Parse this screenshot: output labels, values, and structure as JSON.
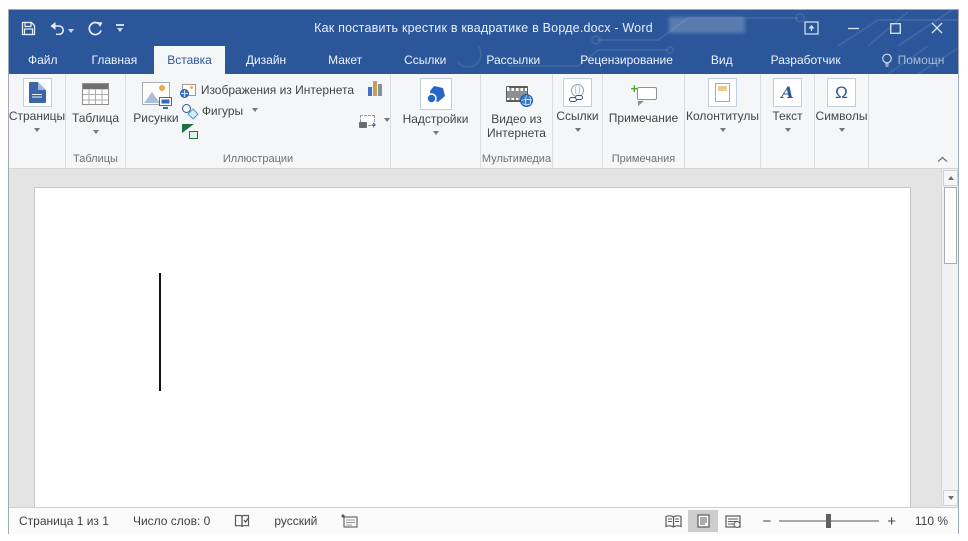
{
  "titlebar": {
    "title": "Как поставить крестик в квадратике в Ворде.docx - Word"
  },
  "tabs": {
    "file": "Файл",
    "home": "Главная",
    "insert": "Вставка",
    "design": "Дизайн",
    "layout": "Макет",
    "references": "Ссылки",
    "mailings": "Рассылки",
    "review": "Рецензирование",
    "view": "Вид",
    "developer": "Разработчик",
    "helper": "Помощн"
  },
  "ribbon": {
    "pages_label": "Страницы",
    "tables_group": "Таблицы",
    "table_label": "Таблица",
    "illustrations_group": "Иллюстрации",
    "pictures_label": "Рисунки",
    "online_pictures_label": "Изображения из Интернета",
    "shapes_label": "Фигуры",
    "addins_label": "Надстройки",
    "media_group": "Мультимедиа",
    "video_label": "Видео из Интернета",
    "links_label": "Ссылки",
    "comments_group": "Примечания",
    "comment_label": "Примечание",
    "header_footer_label": "Колонтитулы",
    "text_label": "Текст",
    "text_glyph": "A",
    "symbols_label": "Символы",
    "symbols_glyph": "Ω"
  },
  "status": {
    "page_indicator": "Страница 1 из 1",
    "word_count": "Число слов: 0",
    "language": "русский",
    "zoom_level": "110 %"
  },
  "colors": {
    "accent_blue": "#2b579a",
    "ribbon_bg": "#f5f6f7",
    "doc_bg": "#e4e4e4",
    "green_plus": "#4ea72e"
  }
}
